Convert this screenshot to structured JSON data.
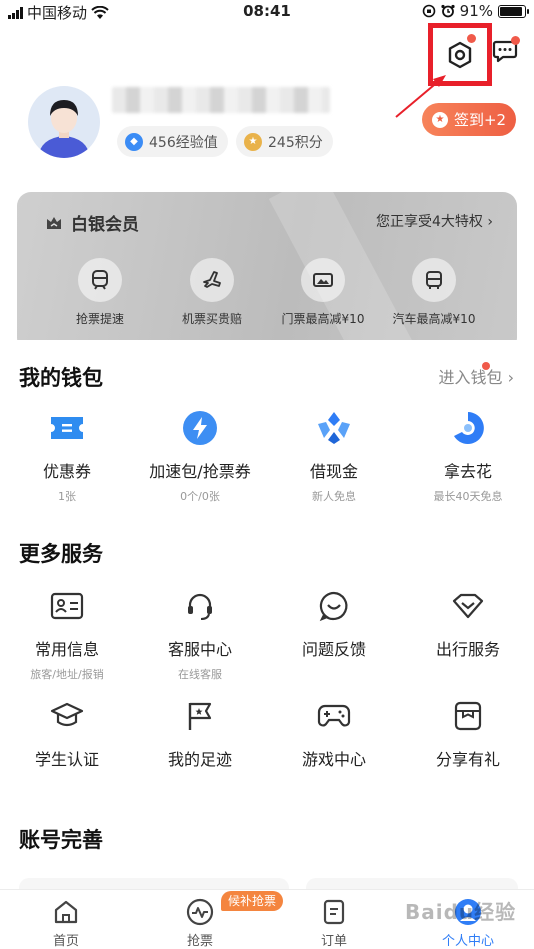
{
  "status_bar": {
    "carrier": "中国移动",
    "time": "08:41",
    "battery": "91%",
    "battery_level": 0.91
  },
  "profile": {
    "badges": [
      {
        "text": "456经验值",
        "icon": "diamond-icon",
        "color": "#3b8cf5"
      },
      {
        "text": "245积分",
        "icon": "star-icon",
        "color": "#e9b24a"
      }
    ],
    "checkin_label": "签到+2"
  },
  "membership": {
    "level": "白银会员",
    "perk_link": "您正享受4大特权",
    "perks": [
      {
        "label": "抢票提速",
        "icon": "train-icon"
      },
      {
        "label": "机票买贵赔",
        "icon": "plane-icon"
      },
      {
        "label": "门票最高减¥10",
        "icon": "ticket-image-icon"
      },
      {
        "label": "汽车最高减¥10",
        "icon": "bus-icon"
      }
    ]
  },
  "wallet": {
    "title": "我的钱包",
    "link": "进入钱包",
    "items": [
      {
        "label": "优惠券",
        "sub": "1张",
        "icon": "coupon-icon"
      },
      {
        "label": "加速包/抢票券",
        "sub": "0个/0张",
        "icon": "lightning-icon"
      },
      {
        "label": "借现金",
        "sub": "新人免息",
        "icon": "cash-icon"
      },
      {
        "label": "拿去花",
        "sub": "最长40天免息",
        "icon": "credit-icon"
      }
    ]
  },
  "services": {
    "title": "更多服务",
    "items": [
      {
        "label": "常用信息",
        "sub": "旅客/地址/报销",
        "icon": "id-card-icon"
      },
      {
        "label": "客服中心",
        "sub": "在线客服",
        "icon": "headset-icon"
      },
      {
        "label": "问题反馈",
        "sub": "",
        "icon": "feedback-icon"
      },
      {
        "label": "出行服务",
        "sub": "",
        "icon": "diamond-outline-icon"
      },
      {
        "label": "学生认证",
        "sub": "",
        "icon": "graduation-cap-icon"
      },
      {
        "label": "我的足迹",
        "sub": "",
        "icon": "flag-icon"
      },
      {
        "label": "游戏中心",
        "sub": "",
        "icon": "gamepad-icon"
      },
      {
        "label": "分享有礼",
        "sub": "",
        "icon": "gift-icon"
      }
    ]
  },
  "account": {
    "title": "账号完善"
  },
  "tab_bar": {
    "badge": "候补抢票",
    "tabs": [
      {
        "label": "首页",
        "icon": "home-icon"
      },
      {
        "label": "抢票",
        "icon": "pulse-icon"
      },
      {
        "label": "订单",
        "icon": "order-icon"
      },
      {
        "label": "个人中心",
        "icon": "user-icon"
      }
    ]
  },
  "watermark": "Baidu经验",
  "colors": {
    "accent": "#2f7df6",
    "checkin": "#ee5f43",
    "highlight_box": "#e8202a",
    "badge_dot": "#f05a4a",
    "tab_badge": "#f4853f"
  }
}
